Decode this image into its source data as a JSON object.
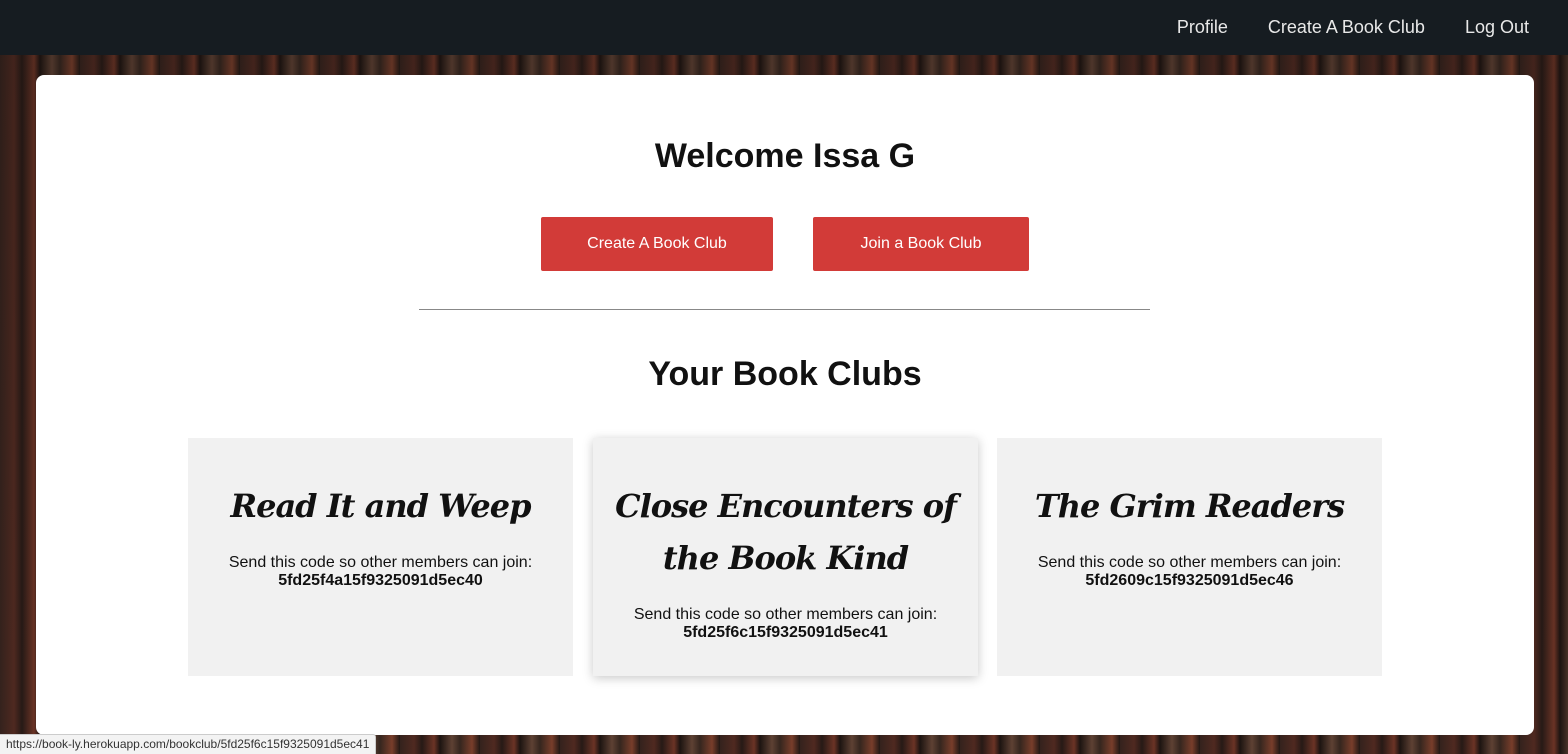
{
  "nav": {
    "profile": "Profile",
    "create": "Create A Book Club",
    "logout": "Log Out"
  },
  "main": {
    "welcome": "Welcome Issa G",
    "create_button": "Create A Book Club",
    "join_button": "Join a Book Club",
    "section_title": "Your Book Clubs"
  },
  "clubs": [
    {
      "name": "Read It and Weep",
      "text": "Send this code so other members can join:",
      "code": "5fd25f4a15f9325091d5ec40"
    },
    {
      "name": "Close Encounters of the Book Kind",
      "text": "Send this code so other members can join:",
      "code": "5fd25f6c15f9325091d5ec41"
    },
    {
      "name": "The Grim Readers",
      "text": "Send this code so other members can join:",
      "code": "5fd2609c15f9325091d5ec46"
    }
  ],
  "status_bar": "https://book-ly.herokuapp.com/bookclub/5fd25f6c15f9325091d5ec41",
  "colors": {
    "navbar": "#161c21",
    "accent": "#d23b38",
    "card_bg": "#f1f1f1"
  }
}
